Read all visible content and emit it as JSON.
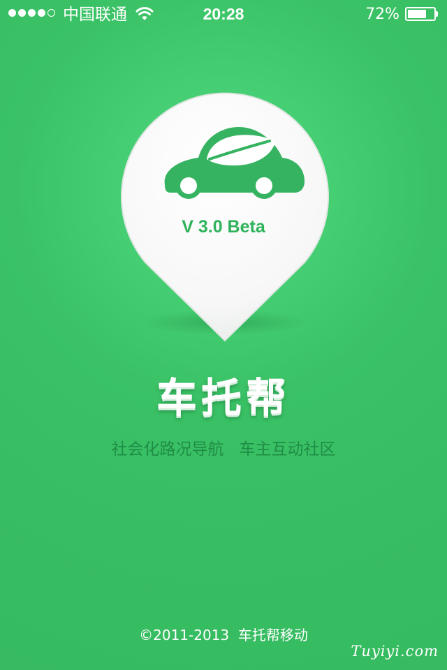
{
  "status_bar": {
    "signal_bars_filled": 4,
    "signal_bars_total": 5,
    "carrier": "中国联通",
    "wifi_icon": "wifi-icon",
    "time": "20:28",
    "battery_percent_text": "72%",
    "battery_level": 0.72,
    "battery_icon": "battery-icon"
  },
  "logo": {
    "icon": "car-leaf-icon",
    "pin_icon": "map-pin-icon",
    "version": "V 3.0 Beta"
  },
  "app": {
    "name": "车托帮",
    "tagline": "社会化路况导航   车主互动社区"
  },
  "footer": {
    "copyright": "©2011-2013  车托帮移动"
  },
  "watermark": "Tuyiyi.com",
  "colors": {
    "background": "#3bc266",
    "accent_dark_green": "#1f8c45",
    "logo_green": "#2eb25a",
    "pin_white": "#f7f8f7"
  }
}
